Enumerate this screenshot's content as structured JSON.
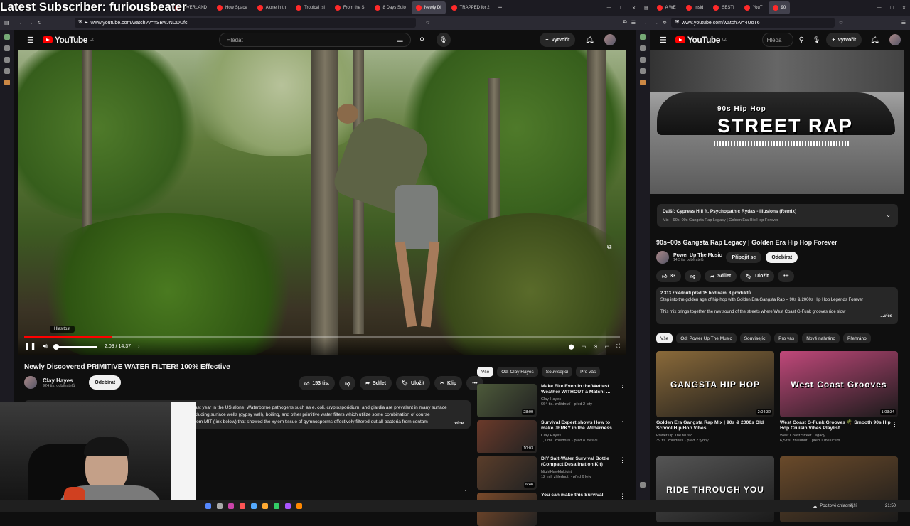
{
  "overlay": {
    "text": "Latest Subscriber: furiousbeater"
  },
  "left_browser": {
    "tabs": [
      "OVERLAND",
      "How Space",
      "Alone in th",
      "Tropical Isl",
      "From the S",
      "8 Days Solo",
      "Newly Di",
      "TRAPPED for 2"
    ],
    "active_tab_index": 6,
    "url": "www.youtube.com/watch?v=nSBwJNDDUfc"
  },
  "right_browser": {
    "tabs": [
      "A WE",
      "Insid",
      "SESTI",
      "YouT",
      "90"
    ],
    "active_tab_index": 4,
    "url": "www.youtube.com/watch?v=4UoT6"
  },
  "left_yt": {
    "logo": "YouTube",
    "region": "CZ",
    "search_placeholder": "Hledat",
    "create_label": "Vytvořit",
    "player": {
      "tooltip": "Hlasitost",
      "time": "2:09 / 14:37",
      "progress": 0.147
    },
    "video_title": "Newly Discovered PRIMITIVE WATER FILTER! 100% Effective",
    "channel": "Clay Hayes",
    "subs": "924 tis. odběratelů",
    "subscribe": "Odebírat",
    "likes": "153 tis.",
    "share": "Sdílet",
    "save": "Uložit",
    "clip": "Klip",
    "description_lines": [
      "ast year in the US alone. Waterborne pathogens such as e. coli, cryptosporidium, and giardia are prevalent in many surface",
      "cluding surface wells (gypsy well), boiling, and other primitive water filters which utilize some combination of course",
      "rom MIT (link below) that showed the xylem tissue of gymnosperms effectively filtered out all bacteria from contam"
    ],
    "more": "...více",
    "chips": [
      "Vše",
      "Od: Clay Hayes",
      "Související",
      "Pro vás"
    ],
    "recs": [
      {
        "title": "Make Fire Even in the Wettest Weather WITHOUT a Match! ...",
        "channel": "Clay Hayes",
        "meta": "664 tis. zhlédnutí · před 2 lety",
        "duration": "28:00",
        "color": "#4d5a3a"
      },
      {
        "title": "Survival Expert shows How to make JERKY in the Wilderness",
        "channel": "Clay Hayes",
        "meta": "1,1 mil. zhlédnutí · před 8 měsíci",
        "duration": "10:03",
        "color": "#6b3a2a"
      },
      {
        "title": "DIY Salt-Water Survival Bottle (Compact Desalination Kit)",
        "channel": "NightHawkInLight",
        "meta": "12 mil. zhlédnutí · před 6 lety",
        "duration": "6:48",
        "color": "#5a3d2a"
      },
      {
        "title": "You can make this Survival",
        "channel": "",
        "meta": "",
        "duration": "",
        "color": "#7a4a2a"
      }
    ]
  },
  "right_yt": {
    "logo": "YouTube",
    "region": "CZ",
    "search_placeholder": "Hleda",
    "create_label": "Vytvořit",
    "banner_small": "90s Hip Hop",
    "banner_big": "STREET RAP",
    "next_label": "Další: Cypress Hill ft. Psychopathic Rydas - Illusions (Remix)",
    "next_mix": "Mix – 90s–00s Gangsta Rap Legacy | Golden Era Hip Hop Forever",
    "video_title": "90s–00s Gangsta Rap Legacy | Golden Era Hip Hop Forever",
    "channel": "Power Up The Music",
    "subs": "14,3 tis. odběratelů",
    "join": "Připojit se",
    "subscribe": "Odebírat",
    "likes": "33",
    "share": "Sdílet",
    "save": "Uložit",
    "desc_meta": "2 313 zhlédnutí  před 15 hodinami  8 produktů",
    "desc_line1": "Step into the golden age of hip-hop with Golden Era Gangsta Rap – 90s & 2000s Hip Hop Legends Forever",
    "desc_line2": "This mix brings together the raw sound of the streets where West Coast G-Funk grooves ride slow",
    "more": "...více",
    "chips": [
      "Vše",
      "Od: Power Up The Music",
      "Související",
      "Pro vás",
      "Nově nahráno",
      "Přehráno"
    ],
    "grid": [
      {
        "thumb_text": "GANGSTA HIP HOP",
        "title": "Golden Era Gangsta Rap Mix | 90s & 2000s Old School Hip Hop Vibes",
        "channel": "Power Up The Music",
        "meta": "39 tis. zhlédnutí · před 2 týdny",
        "duration": "2:04:32",
        "color": "#8a6a3a"
      },
      {
        "thumb_text": "West Coast Grooves",
        "title": "West Coast G-Funk Grooves 🌴 Smooth 90s Hip Hop Cruisin Vibes Playlist",
        "channel": "West Coast Street Legacy",
        "meta": "6,5 tis. zhlédnutí · před 1 měsícem",
        "duration": "1:03:34",
        "color": "#c0487a"
      },
      {
        "thumb_text": "RIDE THROUGH YOU",
        "title": "",
        "channel": "",
        "meta": "",
        "duration": "",
        "color": "#555"
      },
      {
        "thumb_text": "",
        "title": "",
        "channel": "",
        "meta": "",
        "duration": "",
        "color": "#6a4a2a"
      }
    ]
  },
  "taskbar": {
    "weather": "Pocitově chladnější",
    "time": "21:50"
  }
}
